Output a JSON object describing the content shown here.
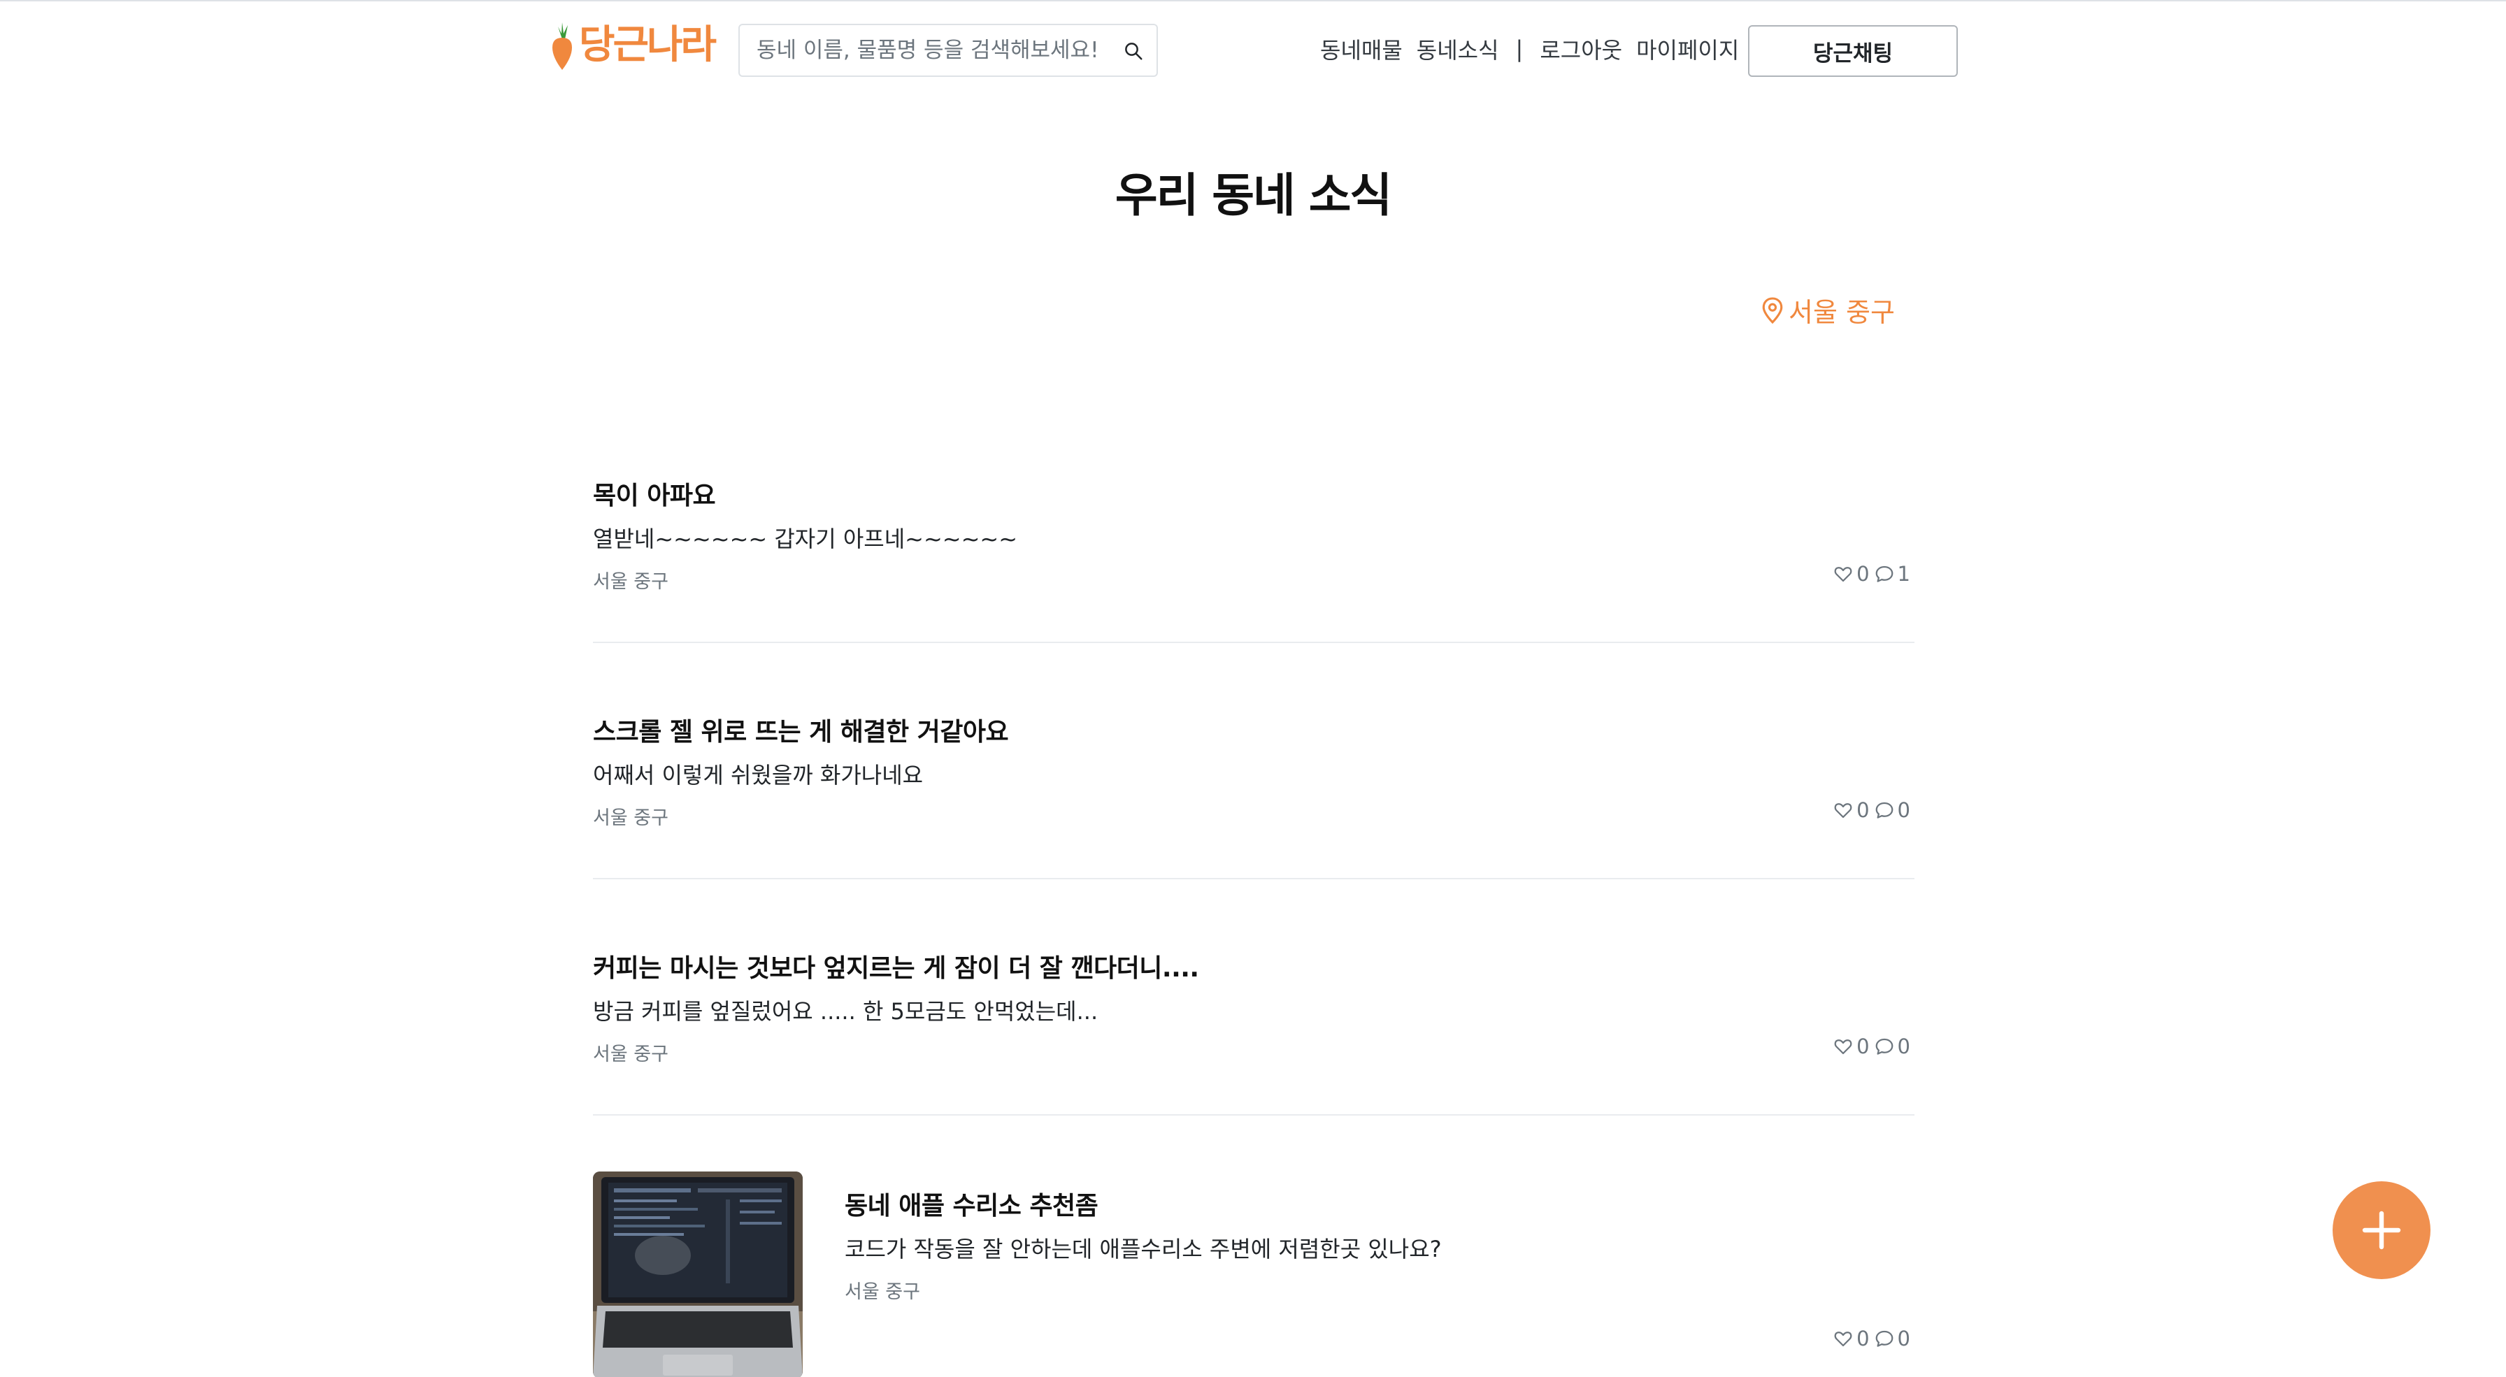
{
  "header": {
    "logo_text": "당근나라",
    "search_placeholder": "동네 이름, 물품명 등을 검색해보세요!",
    "nav": [
      "동네매물",
      "동네소식",
      "로그아웃",
      "마이페이지"
    ],
    "nav_separator": "|",
    "chat_button": "당근채팅"
  },
  "page_title": "우리 동네 소식",
  "location": "서울 중구",
  "colors": {
    "accent": "#f0883e",
    "fab": "#f0904f"
  },
  "posts": [
    {
      "title": "목이 아파요",
      "body": "열받네~~~~~~ 갑자기 아프네~~~~~~",
      "location": "서울 중구",
      "likes": "0",
      "comments": "1",
      "has_image": false
    },
    {
      "title": "스크롤 젤 위로 뜨는 게 해결한 거같아요",
      "body": "어째서 이렇게 쉬웠을까 화가나네요",
      "location": "서울 중구",
      "likes": "0",
      "comments": "0",
      "has_image": false
    },
    {
      "title": "커피는 마시는 것보다 엎지르는 게 잠이 더 잘 깬다더니....",
      "body": "방금 커피를 엎질렀어요 ..... 한 5모금도 안먹었는데...",
      "location": "서울 중구",
      "likes": "0",
      "comments": "0",
      "has_image": false
    },
    {
      "title": "동네 애플 수리소 추천좀",
      "body": "코드가 작동을 잘 안하는데 애플수리소 주변에 저렴한곳 있나요?",
      "location": "서울 중구",
      "likes": "0",
      "comments": "0",
      "has_image": true
    }
  ],
  "icons": {
    "search": "search-icon",
    "location": "map-pin-icon",
    "like": "heart-icon",
    "comment": "comment-icon",
    "add": "plus-icon"
  }
}
